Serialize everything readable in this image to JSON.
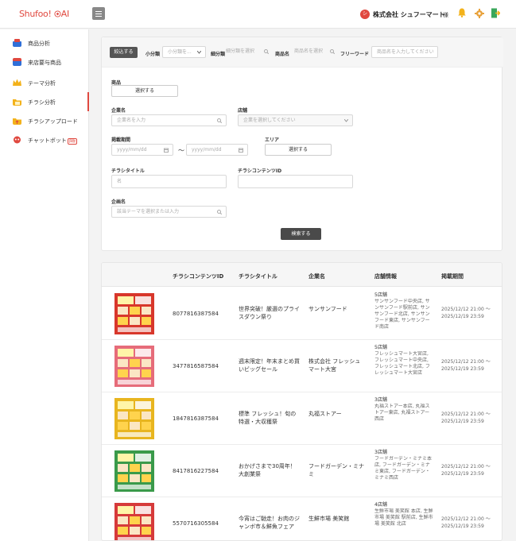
{
  "header": {
    "logo_text": "Shufoo!",
    "logo_ai": "AI",
    "avatar_initial": "シ",
    "company": "株式会社 シュフーマート",
    "honorific": "様"
  },
  "sidebar": {
    "items": [
      {
        "label": "商品分析"
      },
      {
        "label": "来店要与商品"
      },
      {
        "label": "テーマ分析"
      },
      {
        "label": "チラシ分析"
      },
      {
        "label": "チラシアップロード"
      },
      {
        "label": "チャットボット",
        "badge": "β版"
      }
    ]
  },
  "search": {
    "tab_label": "絞込する",
    "subcategory_label": "小分類",
    "subcategory_placeholder": "小分類を...",
    "detail_label": "細分類",
    "detail_placeholder": "細分類を選択",
    "product_label": "商品名",
    "product_placeholder": "商品名を選択",
    "freeword_label": "フリーワード",
    "freeword_placeholder": "商品名を入力してください",
    "product_section_label": "商品",
    "product_select_button": "選択する",
    "company_label": "企業名",
    "company_placeholder": "企業名を入力",
    "store_label": "店舗",
    "store_placeholder": "企業を選択してください",
    "period_label": "掲載期間",
    "date_from_placeholder": "yyyy/mm/dd",
    "date_to_placeholder": "yyyy/mm/dd",
    "period_separator": "〜",
    "area_label": "エリア",
    "area_button": "選択する",
    "flyer_title_label": "チラシタイトル",
    "flyer_title_placeholder": "名",
    "content_id_label": "チラシコンテンツID",
    "theme_label": "企画名",
    "theme_placeholder": "該当テーマを選択または入力",
    "search_button": "検索する"
  },
  "table": {
    "columns": [
      "チラシコンテンツID",
      "チラシタイトル",
      "企業名",
      "店舗情報",
      "掲載期間"
    ],
    "rows": [
      {
        "content_id": "8077816387584",
        "title": "世界突破！厳選のプライスダウン祭り",
        "company": "サンサンフード",
        "store_count": "5店舗",
        "store_detail": "サンサンフード中央店, サンサンフード駅前店, サンサンフード北店, サンサンフード東店, サンサンフード南店",
        "period_from": "2025/12/12 21:00 〜",
        "period_to": "2025/12/19 23:59",
        "thumb_color": "#d8372b"
      },
      {
        "content_id": "3477816587584",
        "title": "週末限定！年末まとめ買いビッグセール",
        "company": "株式会社 フレッシュマート大宮",
        "store_count": "5店舗",
        "store_detail": "フレッシュマート大宮店, フレッシュマート中央店, フレッシュマート北店, フレッシュマート大宮店",
        "period_from": "2025/12/12 21:00 〜",
        "period_to": "2025/12/19 23:59",
        "thumb_color": "#e66c7a"
      },
      {
        "content_id": "1847816387584",
        "title": "標準 フレッシュ！旬の特選・大収穫祭",
        "company": "丸福ストアー",
        "store_count": "3店舗",
        "store_detail": "丸福ストアー本店, 丸福ストアー東店, 丸福ストアー西店",
        "period_from": "2025/12/12 21:00 〜",
        "period_to": "2025/12/19 23:59",
        "thumb_color": "#e8b51f"
      },
      {
        "content_id": "8417816227584",
        "title": "おかげさまで30周年！大創業祭",
        "company": "フードガーデン・ミナミ",
        "store_count": "3店舗",
        "store_detail": "フードガーデン・ミナミ本店, フードガーデン・ミナミ東店, フードガーデン・ミナミ西店",
        "period_from": "2025/12/12 21:00 〜",
        "period_to": "2025/12/19 23:59",
        "thumb_color": "#3a9a4a"
      },
      {
        "content_id": "5570716305584",
        "title": "今宵はご馳走！お肉のジャンボ市＆鮮魚フェア",
        "company": "生鮮市場 美笑館",
        "store_count": "4店舗",
        "store_detail": "生鮮市場 美笑館 本店, 生鮮市場 美笑館 駅前店, 生鮮市場 美笑館 北店",
        "period_from": "2025/12/12 21:00 〜",
        "period_to": "2025/12/19 23:59",
        "thumb_color": "#d63a3a"
      }
    ]
  }
}
